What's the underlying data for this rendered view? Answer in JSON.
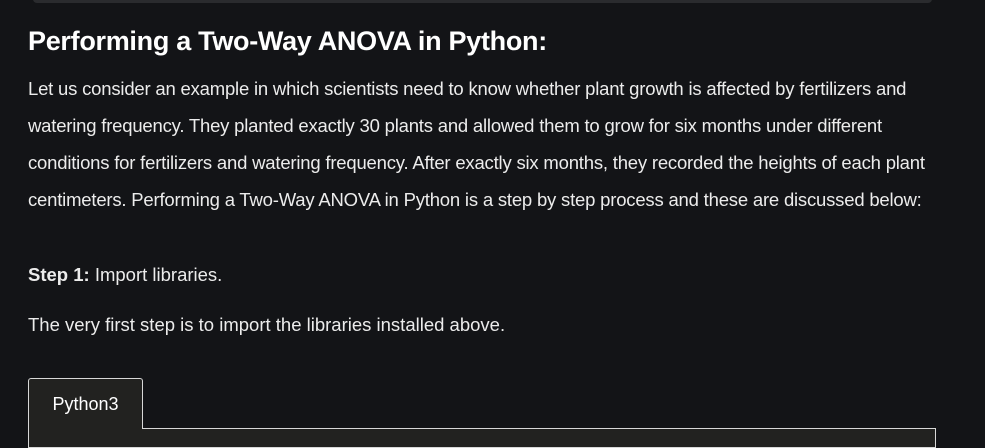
{
  "article": {
    "heading": "Performing a Two-Way ANOVA in Python:",
    "paragraph": "Let us consider an example in which scientists need to know whether plant growth is affected by fertilizers and watering frequency. They planted exactly 30 plants and allowed them to grow for six months under different conditions for fertilizers and watering frequency. After exactly six months, they recorded the heights of each plant centimeters. Performing a Two-Way ANOVA in Python is a step by step process and these are discussed below:",
    "step_label": "Step 1:",
    "step_text": " Import libraries.",
    "step_intro": "The very first step is to import the libraries installed above."
  },
  "code_block": {
    "tab_label": "Python3"
  }
}
